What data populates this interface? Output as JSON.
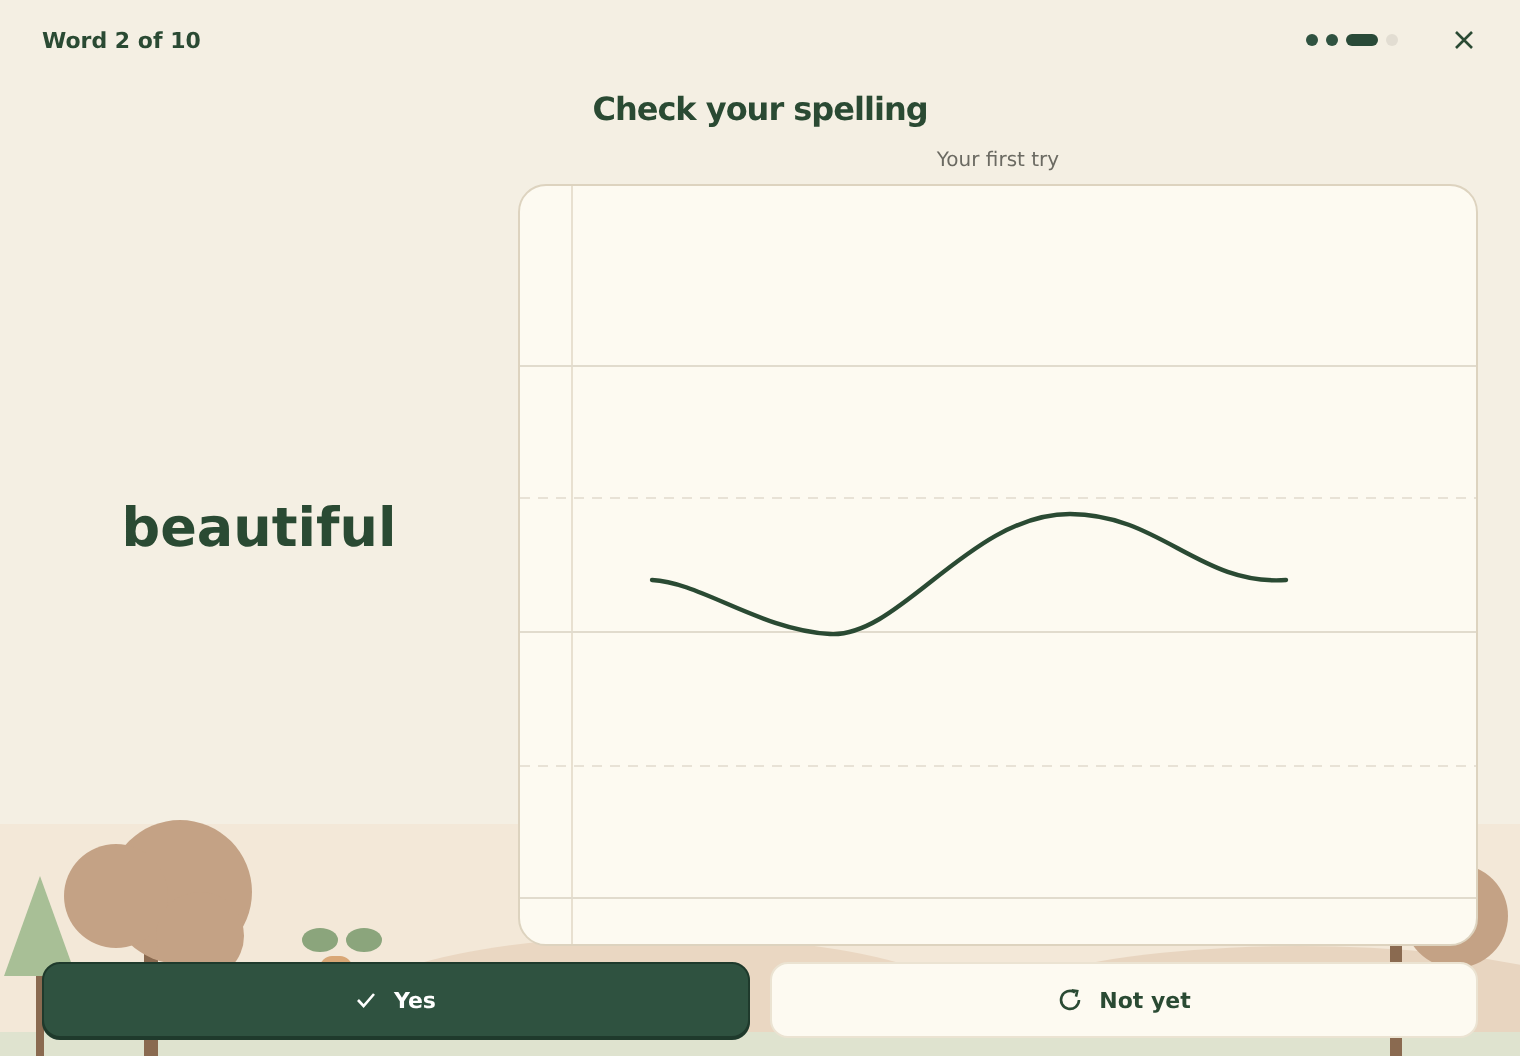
{
  "header": {
    "counter": "Word 2 of 10",
    "progress": [
      {
        "completed": true,
        "selected": false
      },
      {
        "completed": true,
        "selected": false
      },
      {
        "completed": false,
        "selected": true
      },
      {
        "completed": false,
        "selected": false
      }
    ]
  },
  "title": "Check your spelling",
  "word": "beautiful",
  "attempt": {
    "label": "Your first try"
  },
  "buttons": [
    {
      "label": "Yes",
      "kind": "confirm"
    },
    {
      "label": "Not yet",
      "kind": "retry"
    }
  ]
}
